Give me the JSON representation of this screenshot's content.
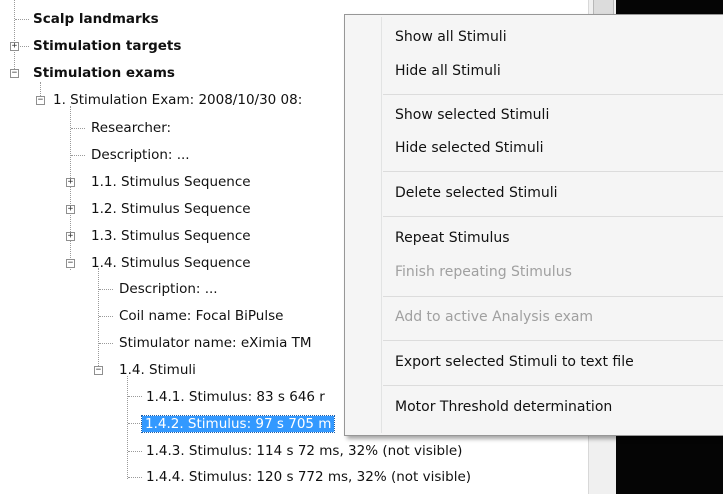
{
  "tree": {
    "scalp_landmarks": "Scalp landmarks",
    "stimulation_targets": "Stimulation targets",
    "stimulation_exams": "Stimulation exams",
    "exam1": "1. Stimulation Exam: 2008/10/30 08:",
    "researcher": "Researcher:",
    "description": "Description: ...",
    "seq_1_1": "1.1. Stimulus Sequence",
    "seq_1_2": "1.2. Stimulus Sequence",
    "seq_1_3": "1.3. Stimulus Sequence",
    "seq_1_4": "1.4. Stimulus Sequence",
    "seq_description": "Description: ...",
    "coil_name": "Coil name: Focal BiPulse",
    "stimulator_name": "Stimulator name: eXimia TM",
    "stimuli": "1.4. Stimuli",
    "stim_1_4_1": "1.4.1. Stimulus: 83 s 646 r",
    "stim_1_4_2": "1.4.2. Stimulus: 97 s 705 m",
    "stim_1_4_3": "1.4.3. Stimulus: 114 s 72 ms, 32% (not visible)",
    "stim_1_4_4": "1.4.4. Stimulus: 120 s 772 ms, 32% (not visible)"
  },
  "expanders": {
    "plus": "+",
    "minus": "−"
  },
  "context_menu": {
    "show_all": "Show all Stimuli",
    "hide_all": "Hide all Stimuli",
    "show_selected": "Show selected Stimuli",
    "hide_selected": "Hide selected Stimuli",
    "delete_selected": "Delete selected Stimuli",
    "repeat": "Repeat Stimulus",
    "finish_repeating": "Finish repeating Stimulus",
    "add_to_analysis": "Add to active Analysis exam",
    "export": "Export selected Stimuli to text file",
    "motor_threshold": "Motor Threshold determination"
  },
  "colors": {
    "selection": "#3399ff",
    "menu_background": "#f5f5f5",
    "viewer_background": "#050505",
    "disabled_text": "#a0a0a0"
  }
}
